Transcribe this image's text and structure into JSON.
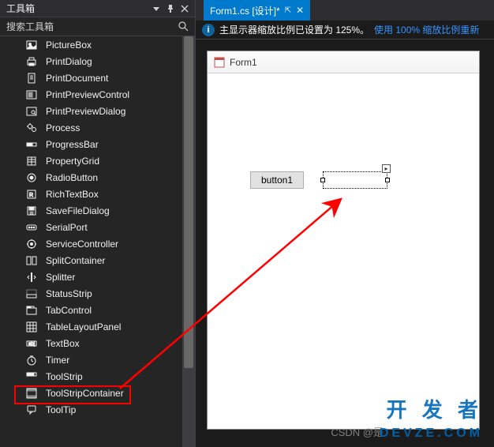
{
  "toolbox": {
    "title": "工具箱",
    "search_placeholder": "搜索工具箱",
    "items": [
      {
        "label": "PictureBox",
        "icon": "picturebox"
      },
      {
        "label": "PrintDialog",
        "icon": "printdialog"
      },
      {
        "label": "PrintDocument",
        "icon": "printdocument"
      },
      {
        "label": "PrintPreviewControl",
        "icon": "printpreviewcontrol"
      },
      {
        "label": "PrintPreviewDialog",
        "icon": "printpreviewdialog"
      },
      {
        "label": "Process",
        "icon": "process"
      },
      {
        "label": "ProgressBar",
        "icon": "progressbar"
      },
      {
        "label": "PropertyGrid",
        "icon": "propertygrid"
      },
      {
        "label": "RadioButton",
        "icon": "radiobutton"
      },
      {
        "label": "RichTextBox",
        "icon": "richtextbox"
      },
      {
        "label": "SaveFileDialog",
        "icon": "savefiledialog"
      },
      {
        "label": "SerialPort",
        "icon": "serialport"
      },
      {
        "label": "ServiceController",
        "icon": "servicecontroller"
      },
      {
        "label": "SplitContainer",
        "icon": "splitcontainer"
      },
      {
        "label": "Splitter",
        "icon": "splitter"
      },
      {
        "label": "StatusStrip",
        "icon": "statusstrip"
      },
      {
        "label": "TabControl",
        "icon": "tabcontrol"
      },
      {
        "label": "TableLayoutPanel",
        "icon": "tablelayoutpanel"
      },
      {
        "label": "TextBox",
        "icon": "textbox",
        "highlighted": true
      },
      {
        "label": "Timer",
        "icon": "timer"
      },
      {
        "label": "ToolStrip",
        "icon": "toolstrip"
      },
      {
        "label": "ToolStripContainer",
        "icon": "toolstripcontainer"
      },
      {
        "label": "ToolTip",
        "icon": "tooltip"
      }
    ]
  },
  "editor": {
    "tab_label": "Form1.cs [设计]*",
    "infobar_text": "主显示器缩放比例已设置为 125%。",
    "infobar_link": "使用 100% 缩放比例重新",
    "form_title": "Form1",
    "button_label": "button1"
  },
  "watermark": {
    "line1": "开 发 者",
    "line2": "DEVZE.COM",
    "csdn": "CSDN @是"
  }
}
